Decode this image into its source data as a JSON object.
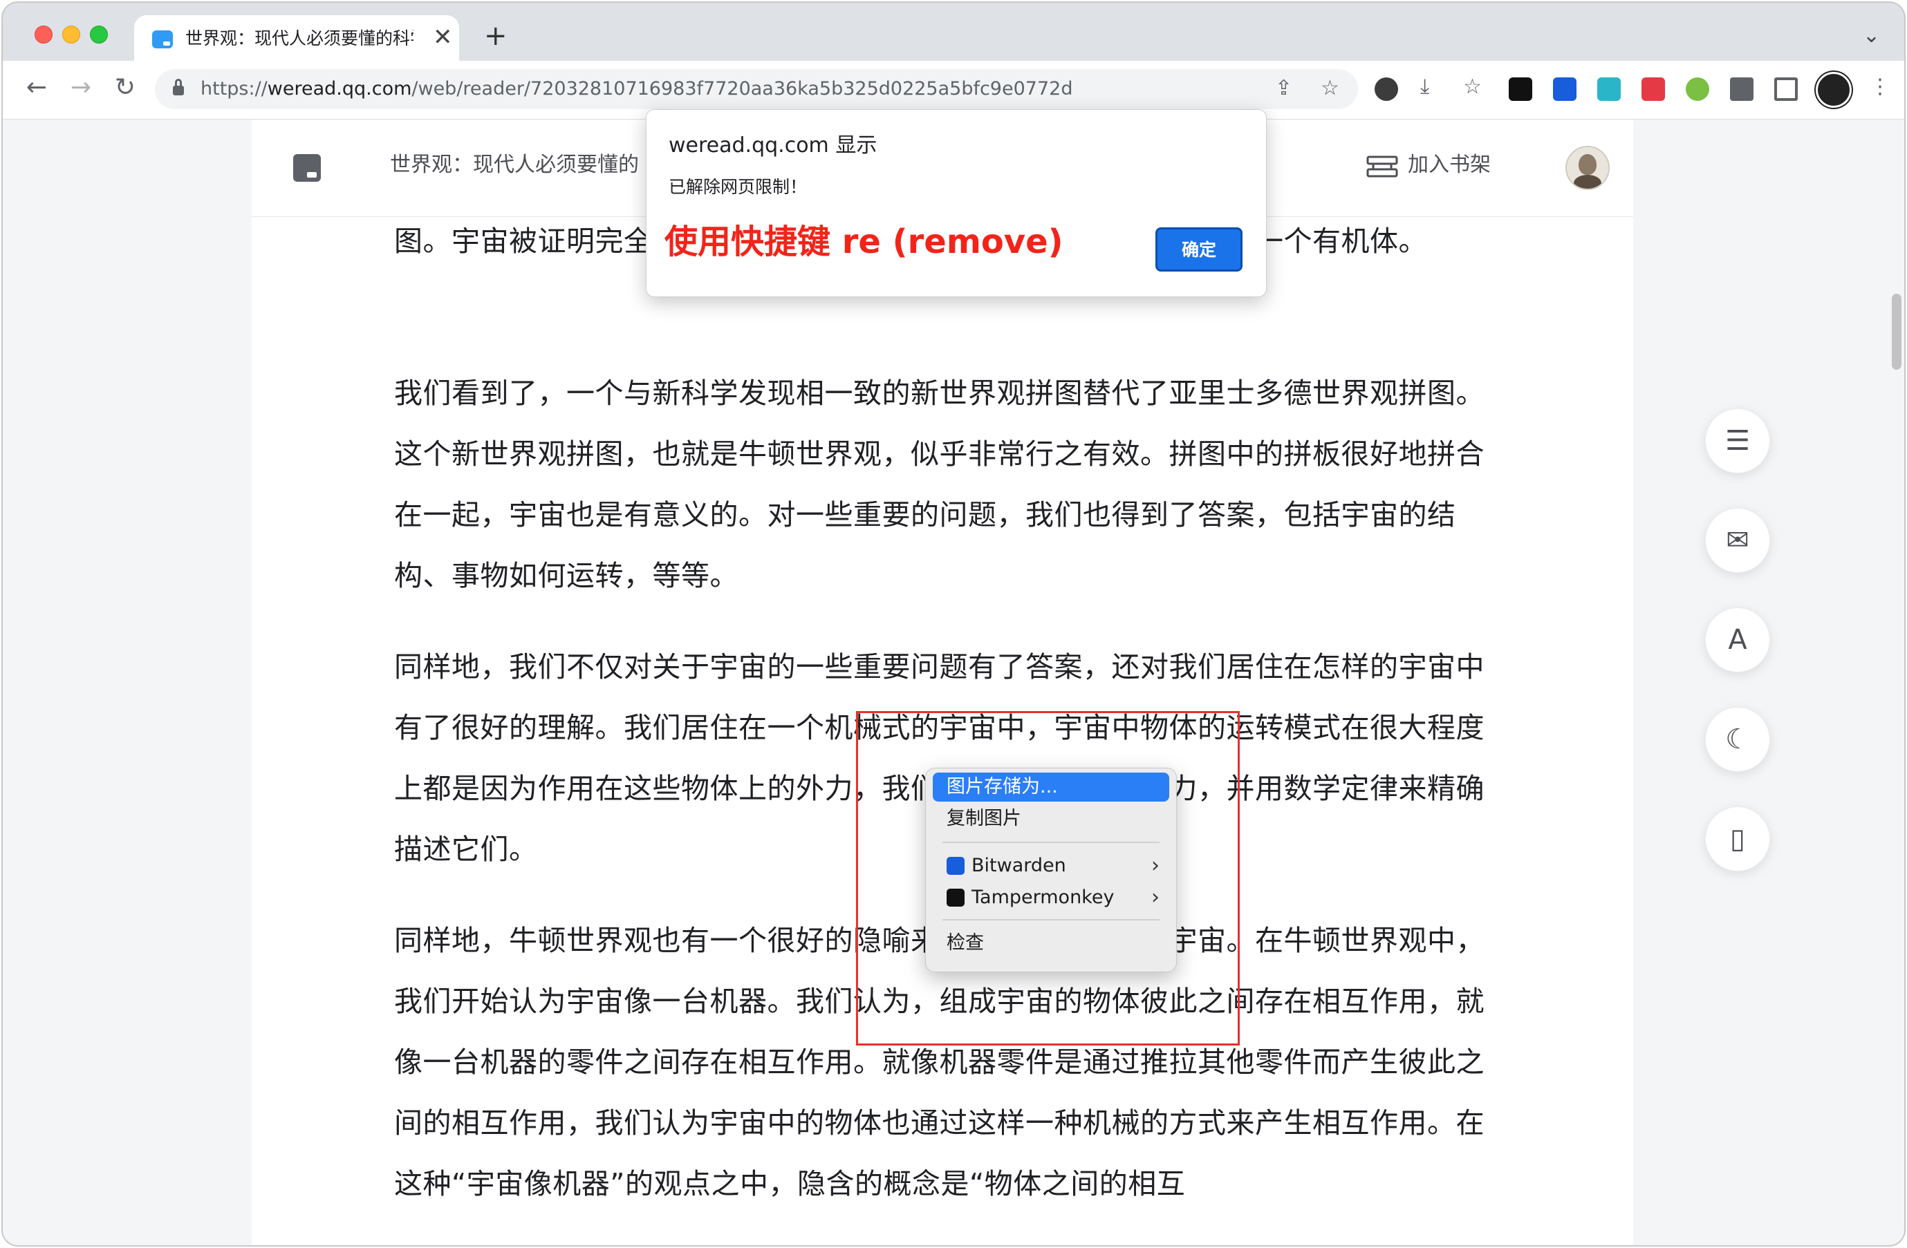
{
  "browser": {
    "tab_title": "世界观：现代人必须要懂的科学哲学",
    "url_prefix": "https://",
    "url_host": "weread.qq.com",
    "url_path": "/web/reader/72032810716983f7720aa36ka5b325d0225a5bfc9e0772d",
    "tab_close": "✕",
    "new_tab": "+",
    "tab_menu": "⌄",
    "icons": {
      "back": "←",
      "forward": "→",
      "reload": "↻",
      "share": "⇪",
      "star": "☆",
      "download": "⤓",
      "more": "⋮"
    }
  },
  "reader": {
    "book_title": "世界观：现代人必须要懂的",
    "add_to_shelf": "加入书架"
  },
  "article": {
    "paragraphs": [
      "图。宇宙被证明完全不像是一个有机体，我们被证明宇宙完全不像是一个有机体。",
      "我们看到了，一个与新科学发现相一致的新世界观拼图替代了亚里士多德世界观拼图。这个新世界观拼图，也就是牛顿世界观，似乎非常行之有效。拼图中的拼板很好地拼合在一起，宇宙也是有意义的。对一些重要的问题，我们也得到了答案，包括宇宙的结构、事物如何运转，等等。",
      "同样地，我们不仅对关于宇宙的一些重要问题有了答案，还对我们居住在怎样的宇宙中有了很好的理解。我们居住在一个机械式的宇宙中，宇宙中物体的运转模式在很大程度上都是因为作用在这些物体上的外力，我们能够发现这些作用力，并用数学定律来精确描述它们。",
      "同样地，牛顿世界观也有一个很好的隐喻来总结我们所居住的宇宙。在牛顿世界观中，我们开始认为宇宙像一台机器。我们认为，组成宇宙的物体彼此之间存在相互作用，就像一台机器的零件之间存在相互作用。就像机器零件是通过推拉其他零件而产生彼此之间的相互作用，我们认为宇宙中的物体也通过这样一种机械的方式来产生相互作用。在这种“宇宙像机器”的观点之中，隐含的概念是“物体之间的相互"
    ]
  },
  "alert": {
    "host": "weread.qq.com 显示",
    "message": "已解除网页限制！",
    "hint": "使用快捷键 re (remove)",
    "ok": "确定"
  },
  "context_menu": {
    "save_image": "图片存储为...",
    "copy_image": "复制图片",
    "bitwarden": "Bitwarden",
    "tampermonkey": "Tampermonkey",
    "inspect": "检查",
    "chevron": "›"
  },
  "fabs": {
    "toc": "☰",
    "notes": "✉",
    "font": "A",
    "dark": "☾",
    "phone": "▯"
  },
  "colors": {
    "highlight": "#2a7ef6",
    "hint_red": "#f2241a",
    "selection_red": "#e5322d",
    "ok_blue": "#1a73e8"
  }
}
